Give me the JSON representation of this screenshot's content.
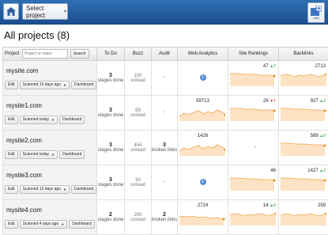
{
  "topbar": {
    "select_label": "Select project",
    "add_label": "Add"
  },
  "page": {
    "title": "All projects (8)"
  },
  "table": {
    "headers": {
      "project": "Project",
      "search_placeholder": "Project or notes",
      "search_button": "Search",
      "todo": "To Do",
      "buzz": "Buzz",
      "audit": "Audit",
      "analytics": "Web Analytics",
      "rankings": "Site Rankings",
      "backlinks": "Backlinks"
    },
    "rows": [
      {
        "name": "mysite.com",
        "edit": "Edit",
        "scanned": "Scanned 13 days ago",
        "dashboard": "Dashboard",
        "todo_num": "3",
        "todo_text": "stages done",
        "buzz_num": "100",
        "buzz_text": "unread",
        "audit_num": "",
        "audit_text": "-",
        "analytics_val": "",
        "rank_val": "47",
        "rank_delta": "2",
        "rank_dir": "up",
        "back_val": "2713",
        "back_delta": "",
        "back_dir": ""
      },
      {
        "name": "mysite1.com",
        "edit": "Edit",
        "scanned": "Scanned today",
        "dashboard": "Dashboard",
        "todo_num": "3",
        "todo_text": "stages done",
        "buzz_num": "99",
        "buzz_text": "unread",
        "audit_num": "",
        "audit_text": "-",
        "analytics_val": "59713",
        "rank_val": "26",
        "rank_delta": "1",
        "rank_dir": "down",
        "back_val": "927",
        "back_delta": "2",
        "back_dir": "up"
      },
      {
        "name": "mysite2.com",
        "edit": "Edit",
        "scanned": "Scanned today",
        "dashboard": "Dashboard",
        "todo_num": "3",
        "todo_text": "stages done",
        "buzz_num": "454",
        "buzz_text": "unread",
        "audit_num": "3",
        "audit_text": "broken links",
        "analytics_val": "1426",
        "rank_val": "-",
        "rank_delta": "",
        "rank_dir": "",
        "back_val": "589",
        "back_delta": "6",
        "back_dir": "up"
      },
      {
        "name": "mysite3.com",
        "edit": "Edit",
        "scanned": "Scanned 13 days ago",
        "dashboard": "Dashboard",
        "todo_num": "3",
        "todo_text": "stages done",
        "buzz_num": "30",
        "buzz_text": "unread",
        "audit_num": "",
        "audit_text": "-",
        "analytics_val": "",
        "rank_val": "46",
        "rank_delta": "",
        "rank_dir": "",
        "back_val": "1427",
        "back_delta": "2",
        "back_dir": "up"
      },
      {
        "name": "mysite4.com",
        "edit": "Edit",
        "scanned": "Scanned 4 days ago",
        "dashboard": "Dashboard",
        "todo_num": "2",
        "todo_text": "stages done",
        "buzz_num": "200",
        "buzz_text": "unread",
        "audit_num": "2",
        "audit_text": "broken links",
        "analytics_val": "2724",
        "rank_val": "14",
        "rank_delta": "6",
        "rank_dir": "up",
        "back_val": "259",
        "back_delta": "",
        "back_dir": ""
      }
    ]
  },
  "colors": {
    "spark_fill": "#fde3c3",
    "spark_line": "#f0a24a",
    "spark_dot": "#f08a1c",
    "topbar": "#1b4f8f"
  }
}
